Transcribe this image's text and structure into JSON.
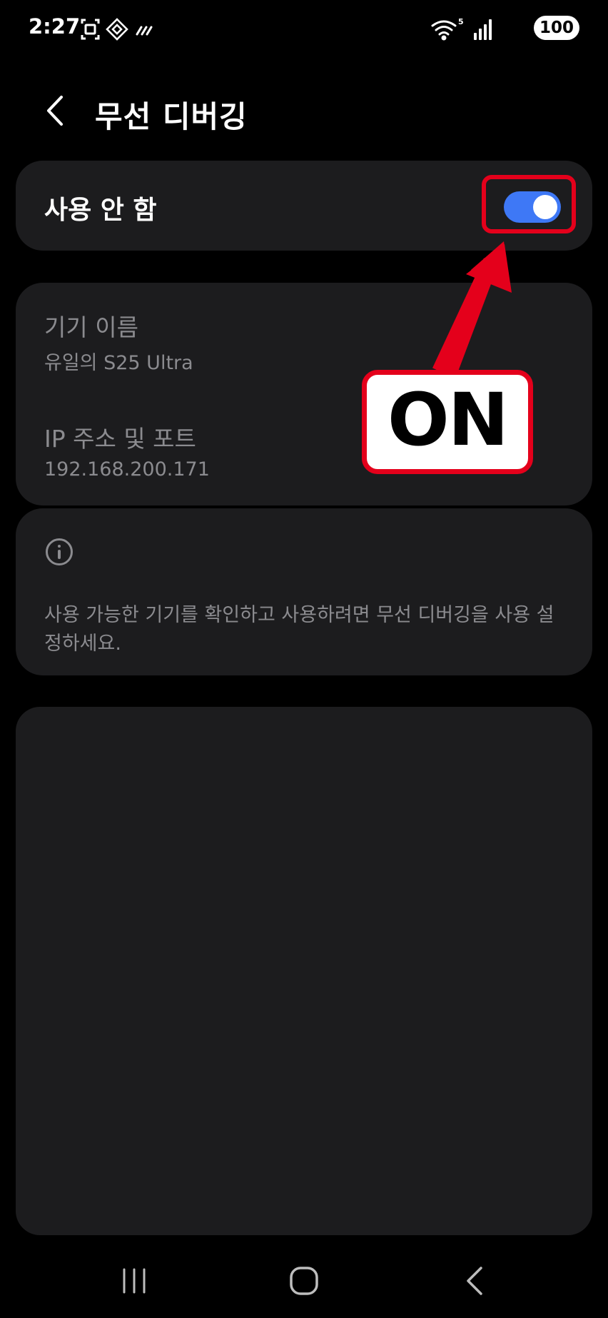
{
  "status_bar": {
    "time": "2:27",
    "battery": "100",
    "left_icons": [
      "screenshot-icon",
      "nfc-diamond-icon",
      "data-saver-icon"
    ],
    "right_icons": [
      "wifi-icon",
      "signal-icon",
      "battery-icon"
    ]
  },
  "header": {
    "title": "무선 디버깅",
    "back_icon": "chevron-left-icon"
  },
  "toggle_row": {
    "label": "사용 안 함",
    "checked": true,
    "switch_color": "#3e78f6"
  },
  "device_info": {
    "device_name_title": "기기 이름",
    "device_name_value": "유일의 S25 Ultra",
    "ip_title": "IP 주소 및 포트",
    "ip_value": "192.168.200.171"
  },
  "notice": {
    "icon": "info-icon",
    "text": "사용 가능한 기기를 확인하고 사용하려면 무선 디버깅을 사용 설정하세요."
  },
  "annotation": {
    "label": "ON",
    "color": "#e4001b"
  },
  "nav_bar": {
    "icons": [
      "recent-apps-icon",
      "home-icon",
      "back-icon"
    ]
  }
}
